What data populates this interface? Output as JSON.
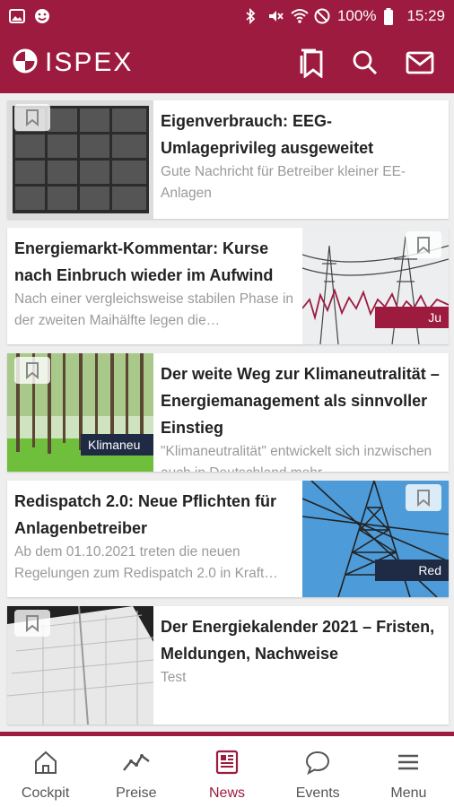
{
  "status_bar": {
    "battery": "100%",
    "time": "15:29",
    "icons": [
      "image-icon",
      "smiley-icon",
      "bluetooth-icon",
      "mute-icon",
      "wifi-icon",
      "do-not-disturb-icon",
      "battery-icon"
    ]
  },
  "app": {
    "logo_text": "ISPEX",
    "actions": [
      "bookmarks-icon",
      "search-icon",
      "mail-icon"
    ]
  },
  "colors": {
    "brand": "#9c1b3f",
    "title_text": "#222222",
    "summary_text": "#9a9a9a",
    "tag_background": "#1f2a44"
  },
  "articles": [
    {
      "title": "Eigenverbrauch: EEG-Umlageprivileg ausgeweitet",
      "summary": "Gute Nachricht für Betreiber kleiner EE-Anlagen",
      "image": "solar-panels-image",
      "image_side": "left",
      "tag": ""
    },
    {
      "title": "Energiemarkt-Kommentar: Kurse nach Einbruch wieder im Aufwind",
      "summary": "Nach einer vergleichsweise stabilen Phase in der zweiten Maihälfte legen die…",
      "image": "power-line-chart-image",
      "image_side": "right",
      "tag": "Ju"
    },
    {
      "title": "Der weite Weg zur Klimaneutralität – Energiemanagement als sinnvoller Einstieg",
      "summary": "\"Klimaneutralität\" entwickelt sich inzwischen auch in Deutschland mehr",
      "image": "forest-image",
      "image_side": "left",
      "tag": "Klimaneu"
    },
    {
      "title": "Redispatch 2.0: Neue Pflichten für Anlagenbetreiber",
      "summary": "Ab dem 01.10.2021 treten die neuen Regelungen zum Redispatch 2.0 in Kraft…",
      "image": "pylon-image",
      "image_side": "right",
      "tag": "Red"
    },
    {
      "title": "Der Energiekalender 2021 – Fristen, Meldungen, Nachweise",
      "summary": "Test",
      "image": "calendar-image",
      "image_side": "left",
      "tag": ""
    }
  ],
  "bottom_nav": {
    "items": [
      {
        "label": "Cockpit",
        "icon": "home-icon"
      },
      {
        "label": "Preise",
        "icon": "trend-icon"
      },
      {
        "label": "News",
        "icon": "newspaper-icon"
      },
      {
        "label": "Events",
        "icon": "chat-icon"
      },
      {
        "label": "Menu",
        "icon": "menu-icon"
      }
    ],
    "active": "News"
  }
}
